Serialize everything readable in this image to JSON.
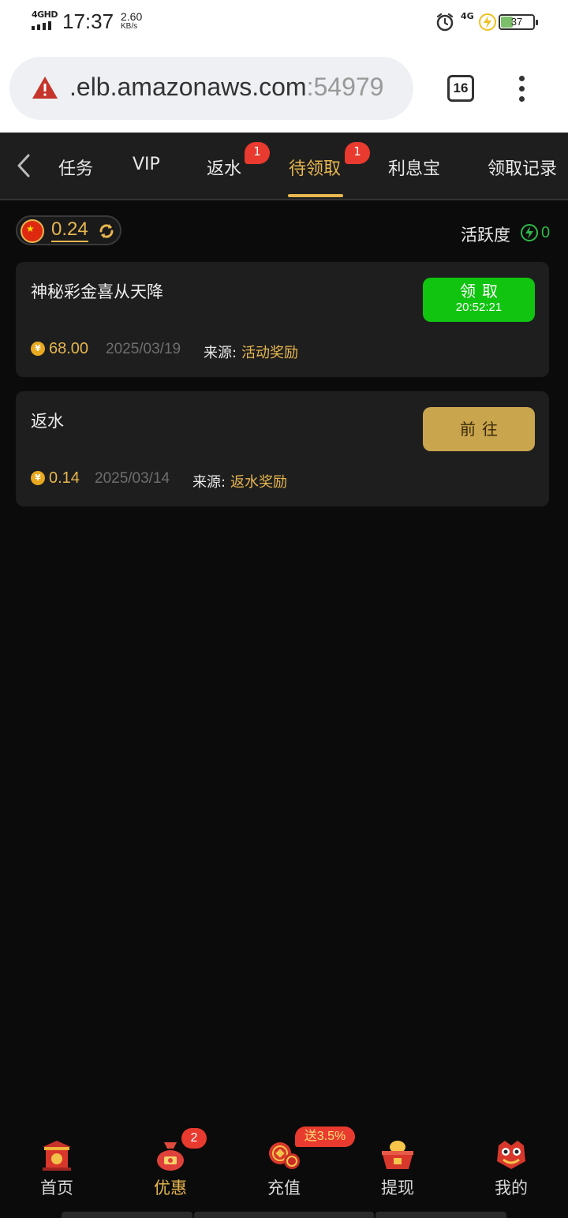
{
  "status_bar": {
    "network": "4GHD",
    "time": "17:37",
    "speed_value": "2.60",
    "speed_unit": "KB/s",
    "network_right": "4G",
    "battery": "37",
    "battery_level_percent": 37
  },
  "browser": {
    "url_main": ".elb.amazonaws.com",
    "url_port": ":54979",
    "tab_count": "16",
    "warning_icon": "warning-triangle-icon",
    "menu_icon": "more-vertical-icon"
  },
  "tabs": {
    "items": [
      {
        "label": "任务"
      },
      {
        "label": "VIP"
      },
      {
        "label": "返水",
        "badge": "1"
      },
      {
        "label": "待领取",
        "badge": "1",
        "active": true
      },
      {
        "label": "利息宝"
      },
      {
        "label": "领取记录"
      }
    ]
  },
  "wallet": {
    "balance": "0.24",
    "flag_icon": "china-flag-icon",
    "refresh_icon": "refresh-icon"
  },
  "activity": {
    "label": "活跃度",
    "value": "0"
  },
  "cards": [
    {
      "title": "神秘彩金喜从天降",
      "button_label": "领取",
      "button_timer": "20:52:21",
      "coin": "¥",
      "amount": "68.00",
      "date": "2025/03/19",
      "source_label": "来源:",
      "source_value": "活动奖励"
    },
    {
      "title": "返水",
      "button_label": "前往",
      "coin": "¥",
      "amount": "0.14",
      "date": "2025/03/14",
      "source_label": "来源:",
      "source_value": "返水奖励"
    }
  ],
  "bottom_nav": {
    "items": [
      {
        "label": "首页"
      },
      {
        "label": "优惠",
        "badge": "2",
        "active": true
      },
      {
        "label": "充值",
        "badge": "送3.5%"
      },
      {
        "label": "提现"
      },
      {
        "label": "我的"
      }
    ]
  },
  "colors": {
    "accent_gold": "#e6b64f",
    "claim_green": "#10c410",
    "badge_red": "#e83a2e",
    "background": "#0b0b0b",
    "card": "#1e1e1e"
  }
}
